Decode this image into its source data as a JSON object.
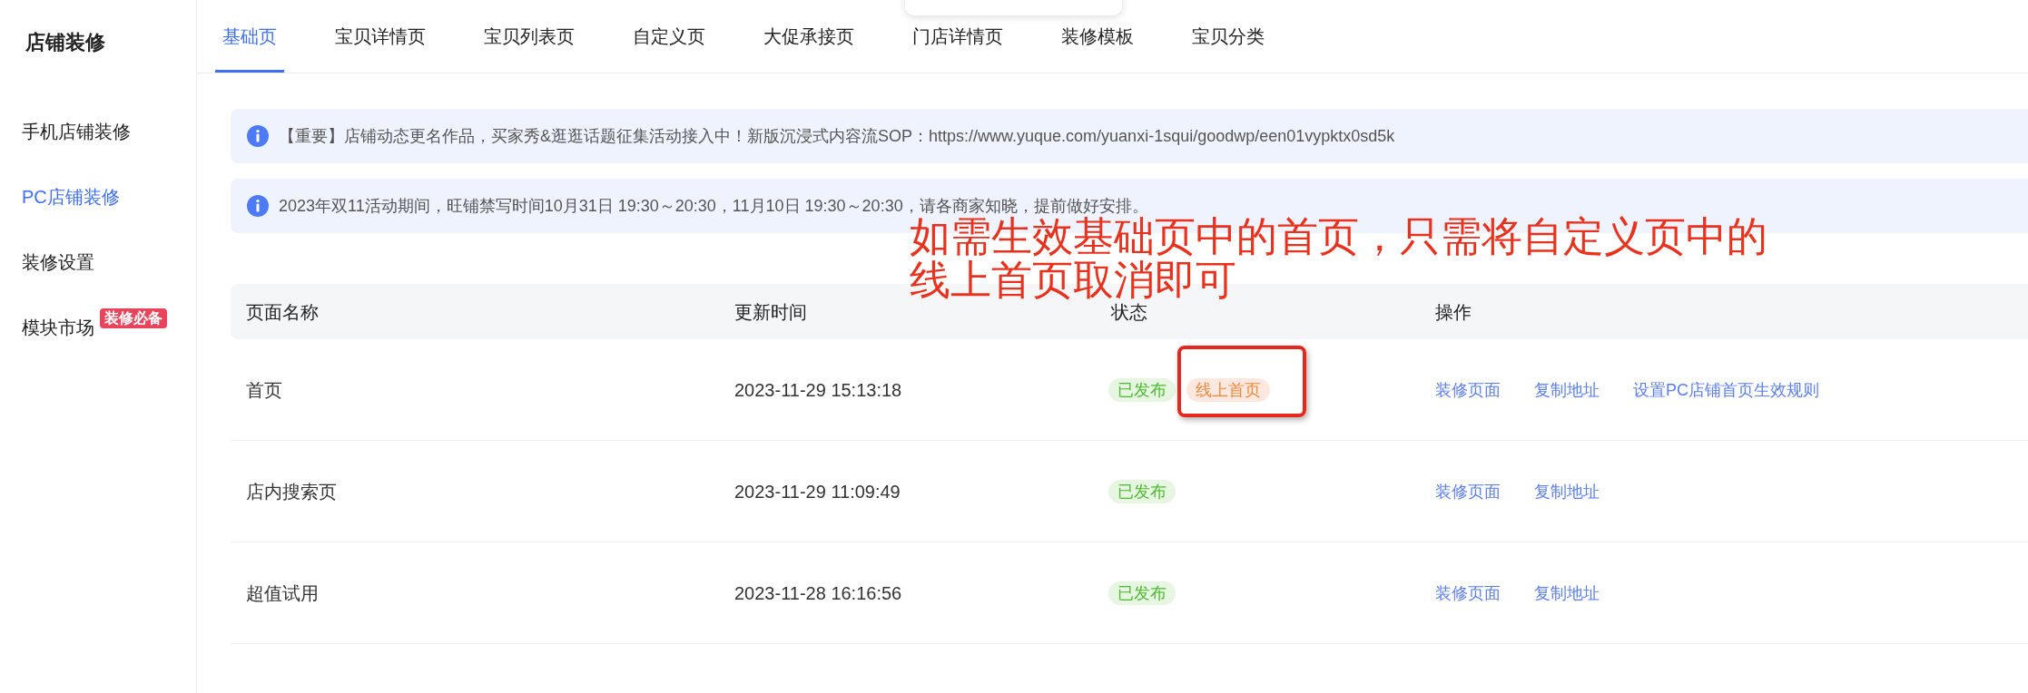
{
  "sidebar": {
    "title": "店铺装修",
    "items": [
      {
        "label": "手机店铺装修",
        "selected": false
      },
      {
        "label": "PC店铺装修",
        "selected": true
      },
      {
        "label": "装修设置",
        "selected": false
      },
      {
        "label": "模块市场",
        "selected": false,
        "badge": "装修必备"
      }
    ]
  },
  "tabs": [
    {
      "label": "基础页",
      "selected": true
    },
    {
      "label": "宝贝详情页",
      "selected": false
    },
    {
      "label": "宝贝列表页",
      "selected": false
    },
    {
      "label": "自定义页",
      "selected": false
    },
    {
      "label": "大促承接页",
      "selected": false
    },
    {
      "label": "门店详情页",
      "selected": false
    },
    {
      "label": "装修模板",
      "selected": false
    },
    {
      "label": "宝贝分类",
      "selected": false
    }
  ],
  "notices": [
    {
      "text": "【重要】店铺动态更名作品，买家秀&逛逛话题征集活动接入中！新版沉浸式内容流SOP：https://www.yuque.com/yuanxi-1squi/goodwp/een01vypktx0sd5k"
    },
    {
      "text": "2023年双11活动期间，旺铺禁写时间10月31日 19:30～20:30，11月10日 19:30～20:30，请各商家知晓，提前做好安排。"
    }
  ],
  "annotation": {
    "text": "如需生效基础页中的首页，只需将自定义页中的线上首页取消即可"
  },
  "table": {
    "columns": [
      "页面名称",
      "更新时间",
      "状态",
      "操作"
    ],
    "rows": [
      {
        "name": "首页",
        "updated": "2023-11-29 15:13:18",
        "tags": [
          {
            "label": "已发布",
            "kind": "published",
            "highlighted": false
          },
          {
            "label": "线上首页",
            "kind": "online_home",
            "highlighted": true
          }
        ],
        "actions": [
          "装修页面",
          "复制地址",
          "设置PC店铺首页生效规则"
        ]
      },
      {
        "name": "店内搜索页",
        "updated": "2023-11-29 11:09:49",
        "tags": [
          {
            "label": "已发布",
            "kind": "published",
            "highlighted": false
          }
        ],
        "actions": [
          "装修页面",
          "复制地址"
        ]
      },
      {
        "name": "超值试用",
        "updated": "2023-11-28 16:16:56",
        "tags": [
          {
            "label": "已发布",
            "kind": "published",
            "highlighted": false
          }
        ],
        "actions": [
          "装修页面",
          "复制地址"
        ]
      }
    ]
  }
}
